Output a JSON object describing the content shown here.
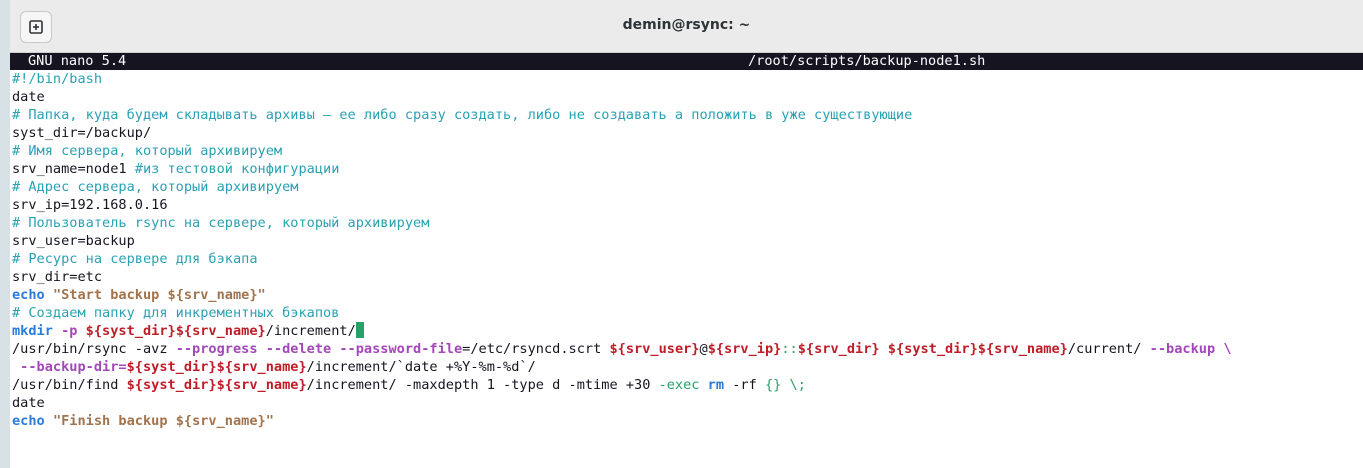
{
  "window": {
    "title": "demin@rsync: ~"
  },
  "nano": {
    "version": "GNU nano 5.4",
    "filename": "/root/scripts/backup-node1.sh"
  },
  "script": {
    "l1": "#!/bin/bash",
    "l2": "date",
    "l3": "# Папка, куда будем складывать архивы — ее либо сразу создать, либо не создавать а положить в уже существующие",
    "l4": "syst_dir",
    "l4b": "=/backup/",
    "l5": "# Имя сервера, который архивируем",
    "l6": "srv_name",
    "l6b": "=node1 ",
    "l6c": "#из тестовой конфигурации",
    "l7": "# Адрес сервера, который архивируем",
    "l8": "srv_ip",
    "l8b": "=192.168.0.16",
    "l9": "# Пользователь rsync на сервере, который архивируем",
    "l10": "srv_user",
    "l10b": "=backup",
    "l11": "# Ресурс на сервере для бэкапа",
    "l12": "srv_dir",
    "l12b": "=etc",
    "l13": "echo",
    "l13b": "\"Start backup ${srv_name}\"",
    "l14": "# Создаем папку для инкрементных бэкапов",
    "l15": "mkdir",
    "l15b": "-p",
    "l15c": "${syst_dir}${srv_name}",
    "l15d": "/increment/",
    "l16a": "/usr/bin/rsync -avz ",
    "l16b": "--progress --delete --password-file",
    "l16c": "=/etc/rsyncd.scrt ",
    "l16d": "${srv_user}",
    "l16e": "@",
    "l16f": "${srv_ip}",
    "l16g": "::",
    "l16h": "${srv_dir}",
    "l16i": "${syst_dir}${srv_name}",
    "l16j": "/current/ ",
    "l16k": "--backup \\",
    "l17a": " --backup-dir=",
    "l17b": "${syst_dir}${srv_name}",
    "l17c": "/increment/`date +%Y-%m-%d`/",
    "l18a": "/usr/bin/find ",
    "l18b": "${syst_dir}${srv_name}",
    "l18c": "/increment/ -maxdepth 1 -type d -mtime +30 ",
    "l18d": "-exec",
    "l18e": "rm",
    "l18f": " -rf ",
    "l18g": "{} \\;",
    "l19": "date",
    "l20": "echo",
    "l20b": "\"Finish backup ${srv_name}\""
  }
}
